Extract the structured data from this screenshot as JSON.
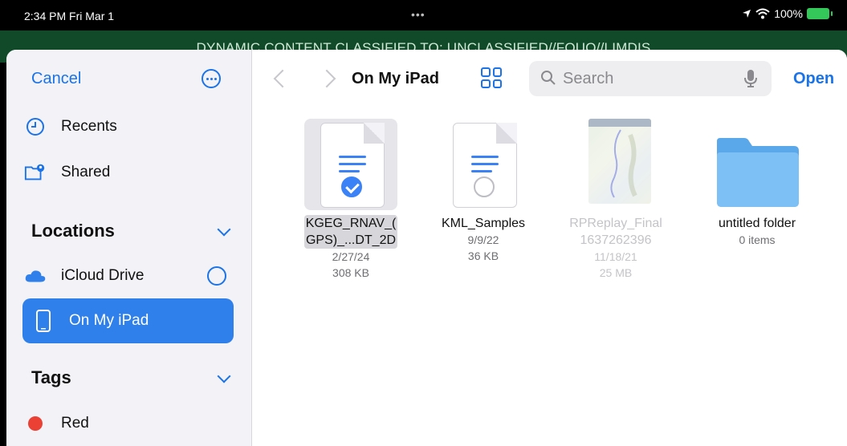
{
  "status_bar": {
    "time": "2:34 PM  Fri Mar 1",
    "dots": "•••",
    "battery": "100%",
    "battery_color": "#34c759"
  },
  "banner": {
    "text": "DYNAMIC CONTENT CLASSIFIED TO: UNCLASSIFIED//FOUO//LIMDIS",
    "bg_color": "#114a29"
  },
  "sidebar": {
    "cancel": "Cancel",
    "nav": [
      {
        "label": "Recents",
        "icon": "clock-icon"
      },
      {
        "label": "Shared",
        "icon": "shared-folder-icon"
      }
    ],
    "locations": {
      "title": "Locations",
      "items": [
        {
          "label": "iCloud Drive",
          "icon": "icloud-icon"
        },
        {
          "label": "On My iPad",
          "icon": "ipad-icon",
          "selected": true
        }
      ]
    },
    "tags": {
      "title": "Tags",
      "items": [
        {
          "label": "Red",
          "color": "#eb4034"
        }
      ]
    }
  },
  "toolbar": {
    "title": "On My iPad",
    "search_placeholder": "Search",
    "open": "Open"
  },
  "files": [
    {
      "name_line1": "KGEG_RNAV_(",
      "name_line2": "GPS)_...DT_2D",
      "date": "2/27/24",
      "size": "308 KB",
      "type": "document",
      "selected": true
    },
    {
      "name_line1": "KML_Samples",
      "name_line2": "",
      "date": "9/9/22",
      "size": "36 KB",
      "type": "document",
      "selected": false
    },
    {
      "name_line1": "RPReplay_Final",
      "name_line2": "1637262396",
      "date": "11/18/21",
      "size": "25 MB",
      "type": "video",
      "disabled": true
    },
    {
      "name_line1": "untitled folder",
      "name_line2": "",
      "date": "0 items",
      "size": "",
      "type": "folder"
    }
  ],
  "colors": {
    "accent": "#1a73e8",
    "selected_row": "#2f80ea",
    "sidebar_bg": "#f2f2f7"
  }
}
